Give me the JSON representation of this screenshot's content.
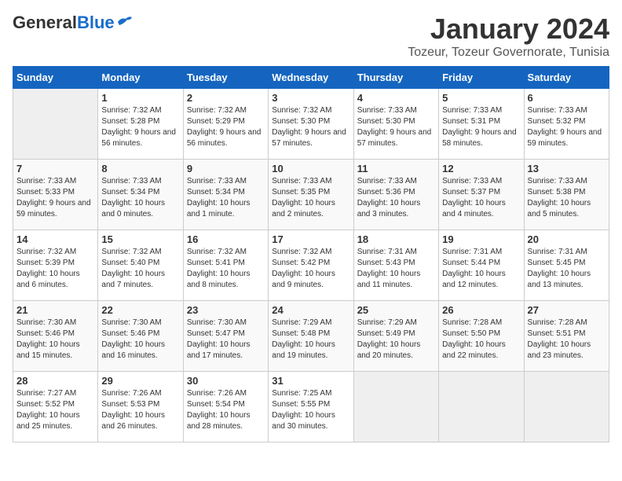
{
  "header": {
    "logo_general": "General",
    "logo_blue": "Blue",
    "month_title": "January 2024",
    "location": "Tozeur, Tozeur Governorate, Tunisia"
  },
  "columns": [
    "Sunday",
    "Monday",
    "Tuesday",
    "Wednesday",
    "Thursday",
    "Friday",
    "Saturday"
  ],
  "weeks": [
    [
      {
        "day": "",
        "empty": true
      },
      {
        "day": "1",
        "sunrise": "Sunrise: 7:32 AM",
        "sunset": "Sunset: 5:28 PM",
        "daylight": "Daylight: 9 hours and 56 minutes."
      },
      {
        "day": "2",
        "sunrise": "Sunrise: 7:32 AM",
        "sunset": "Sunset: 5:29 PM",
        "daylight": "Daylight: 9 hours and 56 minutes."
      },
      {
        "day": "3",
        "sunrise": "Sunrise: 7:32 AM",
        "sunset": "Sunset: 5:30 PM",
        "daylight": "Daylight: 9 hours and 57 minutes."
      },
      {
        "day": "4",
        "sunrise": "Sunrise: 7:33 AM",
        "sunset": "Sunset: 5:30 PM",
        "daylight": "Daylight: 9 hours and 57 minutes."
      },
      {
        "day": "5",
        "sunrise": "Sunrise: 7:33 AM",
        "sunset": "Sunset: 5:31 PM",
        "daylight": "Daylight: 9 hours and 58 minutes."
      },
      {
        "day": "6",
        "sunrise": "Sunrise: 7:33 AM",
        "sunset": "Sunset: 5:32 PM",
        "daylight": "Daylight: 9 hours and 59 minutes."
      }
    ],
    [
      {
        "day": "7",
        "sunrise": "Sunrise: 7:33 AM",
        "sunset": "Sunset: 5:33 PM",
        "daylight": "Daylight: 9 hours and 59 minutes."
      },
      {
        "day": "8",
        "sunrise": "Sunrise: 7:33 AM",
        "sunset": "Sunset: 5:34 PM",
        "daylight": "Daylight: 10 hours and 0 minutes."
      },
      {
        "day": "9",
        "sunrise": "Sunrise: 7:33 AM",
        "sunset": "Sunset: 5:34 PM",
        "daylight": "Daylight: 10 hours and 1 minute."
      },
      {
        "day": "10",
        "sunrise": "Sunrise: 7:33 AM",
        "sunset": "Sunset: 5:35 PM",
        "daylight": "Daylight: 10 hours and 2 minutes."
      },
      {
        "day": "11",
        "sunrise": "Sunrise: 7:33 AM",
        "sunset": "Sunset: 5:36 PM",
        "daylight": "Daylight: 10 hours and 3 minutes."
      },
      {
        "day": "12",
        "sunrise": "Sunrise: 7:33 AM",
        "sunset": "Sunset: 5:37 PM",
        "daylight": "Daylight: 10 hours and 4 minutes."
      },
      {
        "day": "13",
        "sunrise": "Sunrise: 7:33 AM",
        "sunset": "Sunset: 5:38 PM",
        "daylight": "Daylight: 10 hours and 5 minutes."
      }
    ],
    [
      {
        "day": "14",
        "sunrise": "Sunrise: 7:32 AM",
        "sunset": "Sunset: 5:39 PM",
        "daylight": "Daylight: 10 hours and 6 minutes."
      },
      {
        "day": "15",
        "sunrise": "Sunrise: 7:32 AM",
        "sunset": "Sunset: 5:40 PM",
        "daylight": "Daylight: 10 hours and 7 minutes."
      },
      {
        "day": "16",
        "sunrise": "Sunrise: 7:32 AM",
        "sunset": "Sunset: 5:41 PM",
        "daylight": "Daylight: 10 hours and 8 minutes."
      },
      {
        "day": "17",
        "sunrise": "Sunrise: 7:32 AM",
        "sunset": "Sunset: 5:42 PM",
        "daylight": "Daylight: 10 hours and 9 minutes."
      },
      {
        "day": "18",
        "sunrise": "Sunrise: 7:31 AM",
        "sunset": "Sunset: 5:43 PM",
        "daylight": "Daylight: 10 hours and 11 minutes."
      },
      {
        "day": "19",
        "sunrise": "Sunrise: 7:31 AM",
        "sunset": "Sunset: 5:44 PM",
        "daylight": "Daylight: 10 hours and 12 minutes."
      },
      {
        "day": "20",
        "sunrise": "Sunrise: 7:31 AM",
        "sunset": "Sunset: 5:45 PM",
        "daylight": "Daylight: 10 hours and 13 minutes."
      }
    ],
    [
      {
        "day": "21",
        "sunrise": "Sunrise: 7:30 AM",
        "sunset": "Sunset: 5:46 PM",
        "daylight": "Daylight: 10 hours and 15 minutes."
      },
      {
        "day": "22",
        "sunrise": "Sunrise: 7:30 AM",
        "sunset": "Sunset: 5:46 PM",
        "daylight": "Daylight: 10 hours and 16 minutes."
      },
      {
        "day": "23",
        "sunrise": "Sunrise: 7:30 AM",
        "sunset": "Sunset: 5:47 PM",
        "daylight": "Daylight: 10 hours and 17 minutes."
      },
      {
        "day": "24",
        "sunrise": "Sunrise: 7:29 AM",
        "sunset": "Sunset: 5:48 PM",
        "daylight": "Daylight: 10 hours and 19 minutes."
      },
      {
        "day": "25",
        "sunrise": "Sunrise: 7:29 AM",
        "sunset": "Sunset: 5:49 PM",
        "daylight": "Daylight: 10 hours and 20 minutes."
      },
      {
        "day": "26",
        "sunrise": "Sunrise: 7:28 AM",
        "sunset": "Sunset: 5:50 PM",
        "daylight": "Daylight: 10 hours and 22 minutes."
      },
      {
        "day": "27",
        "sunrise": "Sunrise: 7:28 AM",
        "sunset": "Sunset: 5:51 PM",
        "daylight": "Daylight: 10 hours and 23 minutes."
      }
    ],
    [
      {
        "day": "28",
        "sunrise": "Sunrise: 7:27 AM",
        "sunset": "Sunset: 5:52 PM",
        "daylight": "Daylight: 10 hours and 25 minutes."
      },
      {
        "day": "29",
        "sunrise": "Sunrise: 7:26 AM",
        "sunset": "Sunset: 5:53 PM",
        "daylight": "Daylight: 10 hours and 26 minutes."
      },
      {
        "day": "30",
        "sunrise": "Sunrise: 7:26 AM",
        "sunset": "Sunset: 5:54 PM",
        "daylight": "Daylight: 10 hours and 28 minutes."
      },
      {
        "day": "31",
        "sunrise": "Sunrise: 7:25 AM",
        "sunset": "Sunset: 5:55 PM",
        "daylight": "Daylight: 10 hours and 30 minutes."
      },
      {
        "day": "",
        "empty": true
      },
      {
        "day": "",
        "empty": true
      },
      {
        "day": "",
        "empty": true
      }
    ]
  ]
}
